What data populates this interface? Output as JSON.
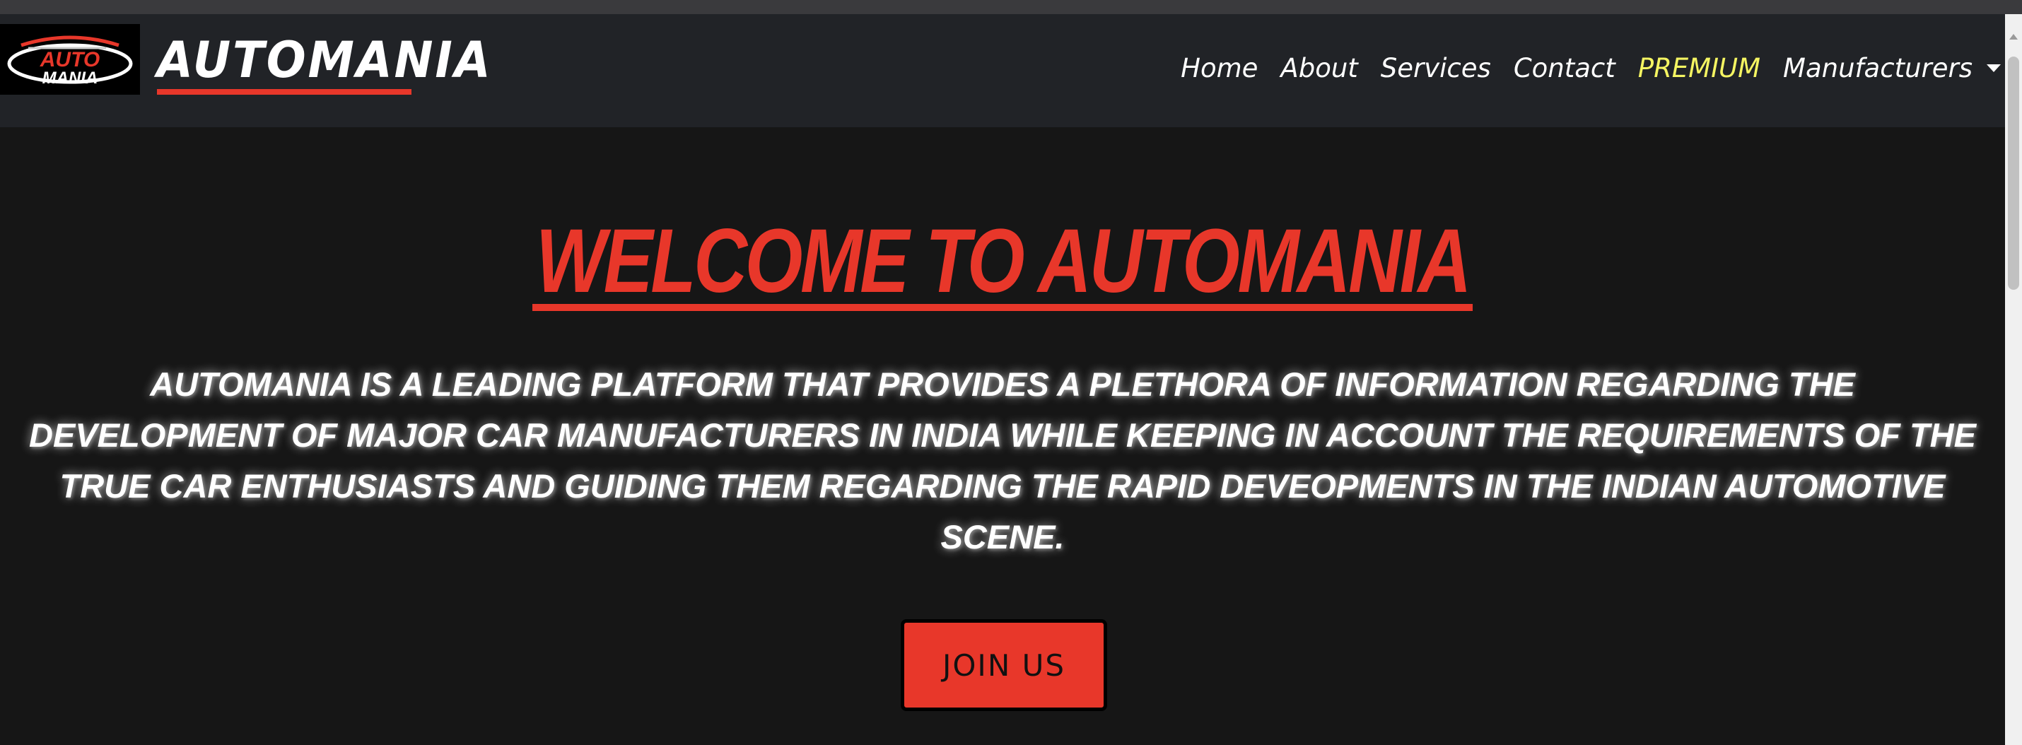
{
  "header": {
    "logo_text_top": "AUTO",
    "logo_text_bottom": "MANIA",
    "brand": "AUTOMANIA"
  },
  "nav": {
    "items": [
      {
        "label": "Home"
      },
      {
        "label": "About"
      },
      {
        "label": "Services"
      },
      {
        "label": "Contact"
      },
      {
        "label": "PREMIUM"
      },
      {
        "label": "Manufacturers"
      }
    ],
    "premium_color": "#f5f562"
  },
  "hero": {
    "title": "WELCOME TO AUTOMANIA",
    "description_lines": [
      "AUTOMANIA IS A LEADING PLATFORM THAT PROVIDES A PLETHORA OF INFORMATION REGARDING THE",
      "DEVELOPMENT OF MAJOR CAR MANUFACTURERS IN INDIA WHILE KEEPING IN ACCOUNT THE REQUIREMENTS OF THE",
      "TRUE CAR ENTHUSIASTS AND GUIDING THEM REGARDING THE RAPID DEVEOPMENTS IN THE INDIAN AUTOMOTIVE",
      "SCENE."
    ],
    "button_label": "JOIN  US"
  },
  "colors": {
    "accent": "#e8372a",
    "navbar_bg": "#212327",
    "page_bg": "#161616"
  }
}
